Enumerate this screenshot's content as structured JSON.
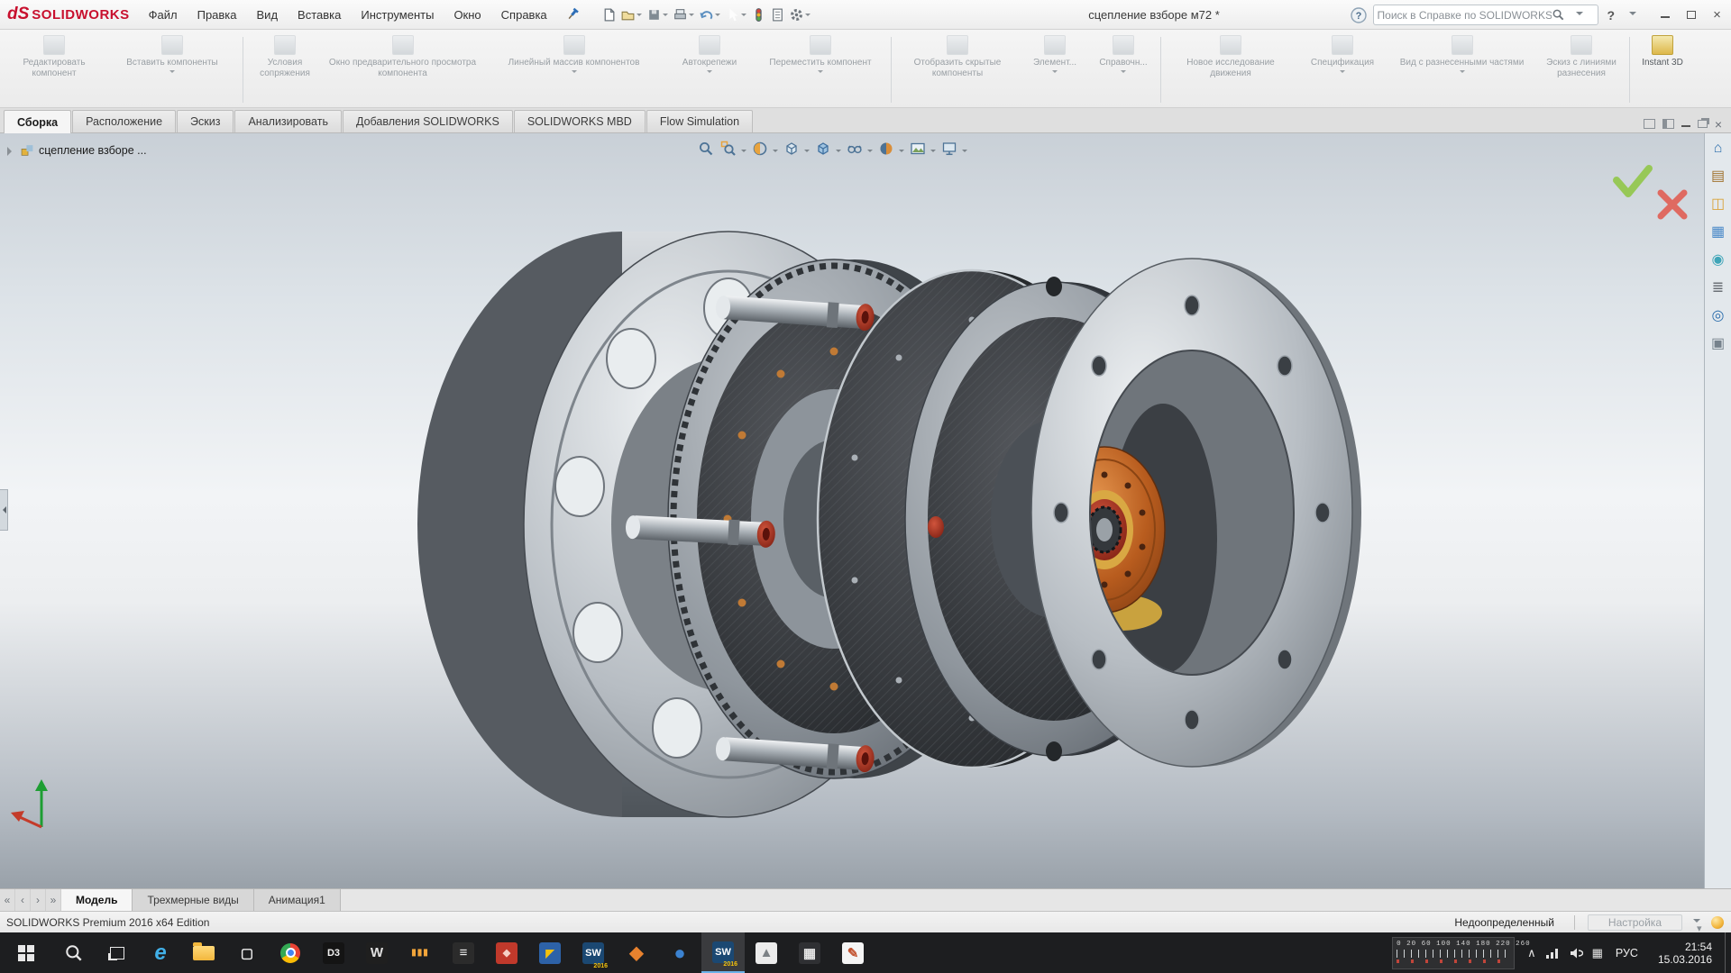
{
  "colors": {
    "accent_blue": "#2d6fad",
    "brand_red": "#c8102e",
    "taskbar_bg": "#1d1e20",
    "viewport_top": "#c9d0d7",
    "viewport_bottom": "#99a1a9",
    "copper": "#b85c1e",
    "metal": "#aab1b7",
    "carbon": "#2e3134",
    "confirm_green": "#8dc63f",
    "cancel_red": "#e2574c"
  },
  "titlebar": {
    "logo_mark": "dS",
    "logo_text": "SOLIDWORKS",
    "menus": [
      "Файл",
      "Правка",
      "Вид",
      "Вставка",
      "Инструменты",
      "Окно",
      "Справка"
    ],
    "document_title": "сцепление взборе м72 *",
    "search_placeholder": "Поиск в Справке по SOLIDWORKS",
    "help_glyph": "?",
    "help_caret": "▾",
    "close_glyph": "×"
  },
  "quick_toolbar": {
    "icons": [
      "new-document",
      "open",
      "save",
      "print",
      "undo",
      "select",
      "rebuild",
      "file-properties",
      "options"
    ]
  },
  "ribbon": {
    "buttons": [
      {
        "label": "Редактировать компонент"
      },
      {
        "label": "Вставить компоненты"
      },
      {
        "label": "Условия сопряжения"
      },
      {
        "label": "Окно предварительного просмотра компонента"
      },
      {
        "label": "Линейный массив компонентов"
      },
      {
        "label": "Автокрепежи"
      },
      {
        "label": "Переместить компонент"
      },
      {
        "label": "Отобразить скрытые компоненты"
      },
      {
        "label": "Элемент..."
      },
      {
        "label": "Справочн..."
      },
      {
        "label": "Новое исследование движения"
      },
      {
        "label": "Спецификация"
      },
      {
        "label": "Вид с разнесенными частями"
      },
      {
        "label": "Эскиз с линиями разнесения"
      },
      {
        "label": "Instant 3D"
      }
    ]
  },
  "command_tabs": {
    "items": [
      "Сборка",
      "Расположение",
      "Эскиз",
      "Анализировать",
      "Добавления SOLIDWORKS",
      "SOLIDWORKS MBD",
      "Flow Simulation"
    ],
    "active": "Сборка"
  },
  "feature_tree": {
    "root": "сцепление взборе ..."
  },
  "headsup": {
    "icons": [
      "zoom-fit",
      "zoom-area",
      "section-view",
      "view-orientation",
      "display-style",
      "hide-show-items",
      "edit-appearance",
      "apply-scene",
      "view-settings"
    ]
  },
  "task_pane": {
    "items": [
      {
        "name": "sw-resources",
        "glyph": "⌂",
        "color": "#2d6fad"
      },
      {
        "name": "design-library",
        "glyph": "▤",
        "color": "#a0722e"
      },
      {
        "name": "file-explorer",
        "glyph": "◫",
        "color": "#d9a33c"
      },
      {
        "name": "view-palette",
        "glyph": "▦",
        "color": "#4a89c8"
      },
      {
        "name": "appearances-scenes",
        "glyph": "◉",
        "color": "#3fa5b8"
      },
      {
        "name": "custom-properties",
        "glyph": "≣",
        "color": "#6b7076"
      },
      {
        "name": "sw-forum",
        "glyph": "◎",
        "color": "#2d6fad"
      },
      {
        "name": "subscription-services",
        "glyph": "▣",
        "color": "#76828c"
      }
    ]
  },
  "model_tabs": {
    "nav": [
      "«",
      "‹",
      "›",
      "»"
    ],
    "items": [
      "Модель",
      "Трехмерные виды",
      "Анимация1"
    ],
    "active": "Модель"
  },
  "statusbar": {
    "edition": "SOLIDWORKS Premium 2016 x64 Edition",
    "doc_state": "Недоопределенный",
    "customize": "Настройка",
    "caret": "▾"
  },
  "taskbar": {
    "lang": "РУС",
    "time": "21:54",
    "date": "15.03.2016",
    "sw_year": "2016",
    "ruler_numbers": "0 20  60  100  140  180  220  260",
    "tray_chevron": "∧",
    "glyph_icons": [
      {
        "name": "edge",
        "glyph": "e",
        "bg": "transparent",
        "fg": "#41b0e8"
      },
      {
        "name": "store",
        "glyph": "▢",
        "bg": "transparent",
        "fg": "#ececec"
      },
      {
        "name": "d3-app",
        "glyph": "D3",
        "bg": "#141414",
        "fg": "#f2f2f2"
      },
      {
        "name": "w-app",
        "glyph": "W",
        "bg": "#1f1f1f",
        "fg": "#e0e0e0"
      },
      {
        "name": "slots-app",
        "glyph": "▮▮▮",
        "bg": "transparent",
        "fg": "#f2a53a"
      },
      {
        "name": "docs-app",
        "glyph": "≡",
        "bg": "#2b2b2b",
        "fg": "#eeeeee"
      },
      {
        "name": "red-app",
        "glyph": "◆",
        "bg": "#c0392b",
        "fg": "#f5d0c5"
      },
      {
        "name": "duo-app",
        "glyph": "◤",
        "bg": "#2d62a8",
        "fg": "#f4c20d"
      },
      {
        "name": "solidworks-2016",
        "glyph": "SW",
        "bg": "#1b4872",
        "fg": "#ffffff"
      },
      {
        "name": "gem-app",
        "glyph": "◆",
        "bg": "transparent",
        "fg": "#e8822e"
      },
      {
        "name": "globe-app",
        "glyph": "●",
        "bg": "transparent",
        "fg": "#3b82d0"
      },
      {
        "name": "solidworks-active",
        "glyph": "SW",
        "bg": "#1b4872",
        "fg": "#ffffff"
      },
      {
        "name": "photos",
        "glyph": "▲",
        "bg": "#ececec",
        "fg": "#7d8286"
      },
      {
        "name": "calculator",
        "glyph": "▦",
        "bg": "#2f3033",
        "fg": "#e8e8e8"
      },
      {
        "name": "paint",
        "glyph": "✎",
        "bg": "#f4f4f4",
        "fg": "#c2512e"
      }
    ]
  }
}
